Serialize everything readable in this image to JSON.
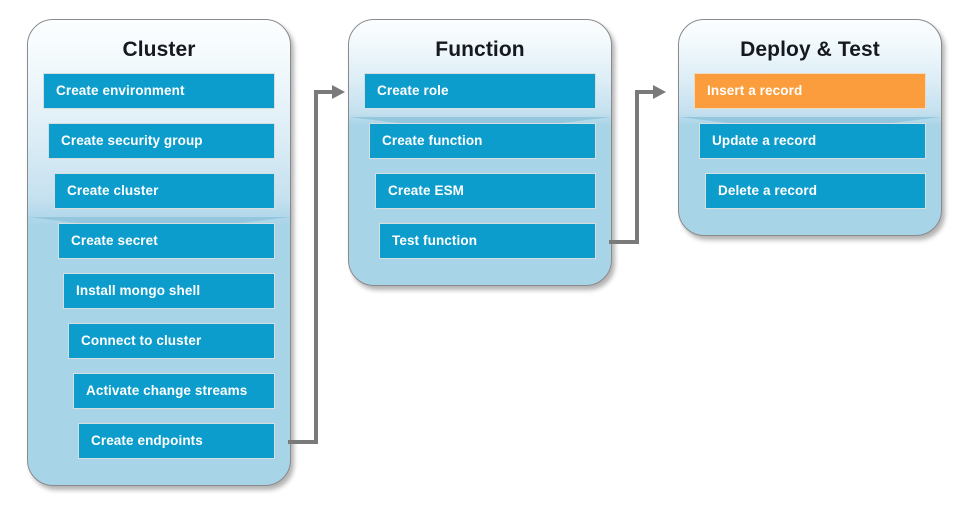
{
  "diagram": {
    "title_text": "",
    "colors": {
      "step_fill": "#0d9dcc",
      "step_highlight_fill": "#fb9d3c",
      "panel_fill": "#a8d4e8",
      "connector": "#7a7a7a",
      "title_text": "#16191f",
      "step_text": "#ffffff"
    },
    "panels": [
      {
        "id": "cluster",
        "title": "Cluster",
        "steps": [
          {
            "label": "Create environment",
            "highlight": false
          },
          {
            "label": "Create security group",
            "highlight": false
          },
          {
            "label": "Create cluster",
            "highlight": false
          },
          {
            "label": "Create secret",
            "highlight": false
          },
          {
            "label": "Install mongo shell",
            "highlight": false
          },
          {
            "label": "Connect to cluster",
            "highlight": false
          },
          {
            "label": "Activate change streams",
            "highlight": false
          },
          {
            "label": "Create endpoints",
            "highlight": false
          }
        ]
      },
      {
        "id": "function",
        "title": "Function",
        "steps": [
          {
            "label": "Create role",
            "highlight": false
          },
          {
            "label": "Create function",
            "highlight": false
          },
          {
            "label": "Create ESM",
            "highlight": false
          },
          {
            "label": "Test function",
            "highlight": false
          }
        ]
      },
      {
        "id": "deploy-test",
        "title": "Deploy & Test",
        "steps": [
          {
            "label": "Insert a record",
            "highlight": true
          },
          {
            "label": "Update a record",
            "highlight": false
          },
          {
            "label": "Delete a record",
            "highlight": false
          }
        ]
      }
    ],
    "connectors": [
      {
        "id": "cluster-to-function",
        "from": "cluster",
        "to": "function",
        "arrow": "arrow-right-icon"
      },
      {
        "id": "function-to-deploy-test",
        "from": "function",
        "to": "deploy-test",
        "arrow": "arrow-right-icon"
      }
    ]
  }
}
